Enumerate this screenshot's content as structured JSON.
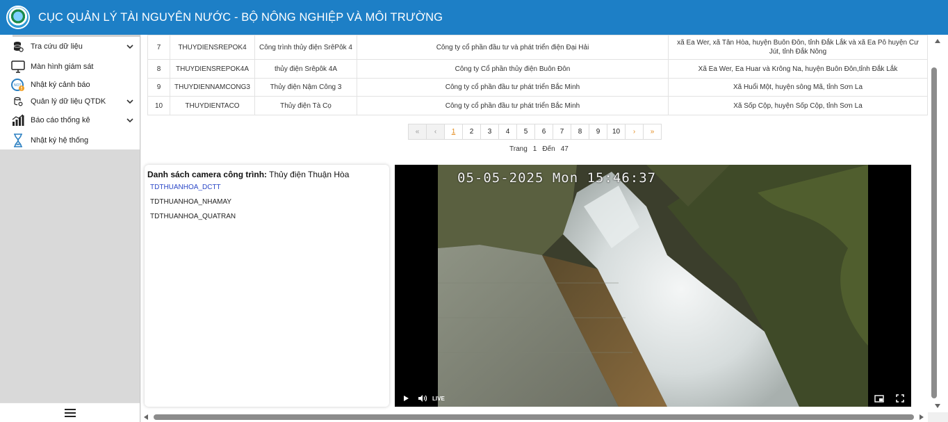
{
  "header": {
    "title": "CỤC QUẢN LÝ TÀI NGUYÊN NƯỚC - BỘ NÔNG NGHIỆP VÀ MÔI TRƯỜNG",
    "bg_color": "#1d7fc6"
  },
  "sidebar": {
    "items": [
      {
        "label": "Tra cứu dữ liệu",
        "icon": "database-icon",
        "has_submenu": true
      },
      {
        "label": "Màn hình giám sát",
        "icon": "monitor-icon",
        "has_submenu": false
      },
      {
        "label": "Nhật ký cảnh báo",
        "icon": "alert-log-icon",
        "has_submenu": false
      },
      {
        "label": "Quản lý dữ liệu QTDK",
        "icon": "data-settings-icon",
        "has_submenu": true
      },
      {
        "label": "Báo cáo thống kê",
        "icon": "bar-chart-icon",
        "has_submenu": true
      },
      {
        "label": "Nhật ký hệ thống",
        "icon": "hourglass-icon",
        "has_submenu": false
      }
    ],
    "bottom_icon": "hamburger-menu-icon"
  },
  "table": {
    "rows": [
      {
        "stt": "7",
        "code": "THUYDIENSREPOK4",
        "name": "Công trình thủy điện SrêPôk 4",
        "owner": "Công ty cổ phần đầu tư và phát triển điện Đại Hải",
        "location": "xã Ea Wer, xã Tân Hòa, huyện Buôn Đôn, tỉnh Đắk Lắk và xã Ea Pô huyện Cư Jút, tỉnh Đắk Nông"
      },
      {
        "stt": "8",
        "code": "THUYDIENSREPOK4A",
        "name": "thủy điện Srêpôk 4A",
        "owner": "Công ty Cổ phần thủy điện Buôn Đôn",
        "location": "Xã Ea Wer, Ea Huar và Krông Na, huyện Buôn Đôn,tỉnh Đắk Lắk"
      },
      {
        "stt": "9",
        "code": "THUYDIENNAMCONG3",
        "name": "Thủy điện Nậm Công 3",
        "owner": "Công ty cổ phần đầu tư phát triển Bắc Minh",
        "location": "Xã Huổi Một, huyện sông Mã, tỉnh Sơn La"
      },
      {
        "stt": "10",
        "code": "THUYDIENTACO",
        "name": "Thủy điện Tà Cọ",
        "owner": "Công ty cổ phần đầu tư phát triển Bắc Minh",
        "location": "Xã Sốp Cộp, huyện Sốp Cộp, tỉnh Sơn La"
      }
    ]
  },
  "pagination": {
    "first": "«",
    "prev": "‹",
    "pages": [
      "1",
      "2",
      "3",
      "4",
      "5",
      "6",
      "7",
      "8",
      "9",
      "10"
    ],
    "current": "1",
    "next": "›",
    "last": "»",
    "info_label": "Trang",
    "info_current": "1",
    "info_to": "Đến",
    "info_total": "47",
    "accent": "#e38b1e"
  },
  "camera_panel": {
    "title_label": "Danh sách camera công trình:",
    "title_value": "Thủy điện Thuận Hòa",
    "cameras": [
      "TDTHUANHOA_DCTT",
      "TDTHUANHOA_NHAMAY",
      "TDTHUANHOA_QUATRAN"
    ],
    "selected_index": 0,
    "selected_color": "#2a47c7"
  },
  "video": {
    "timestamp": "05-05-2025 Mon 15:46:37",
    "live_label": "LIVE"
  }
}
